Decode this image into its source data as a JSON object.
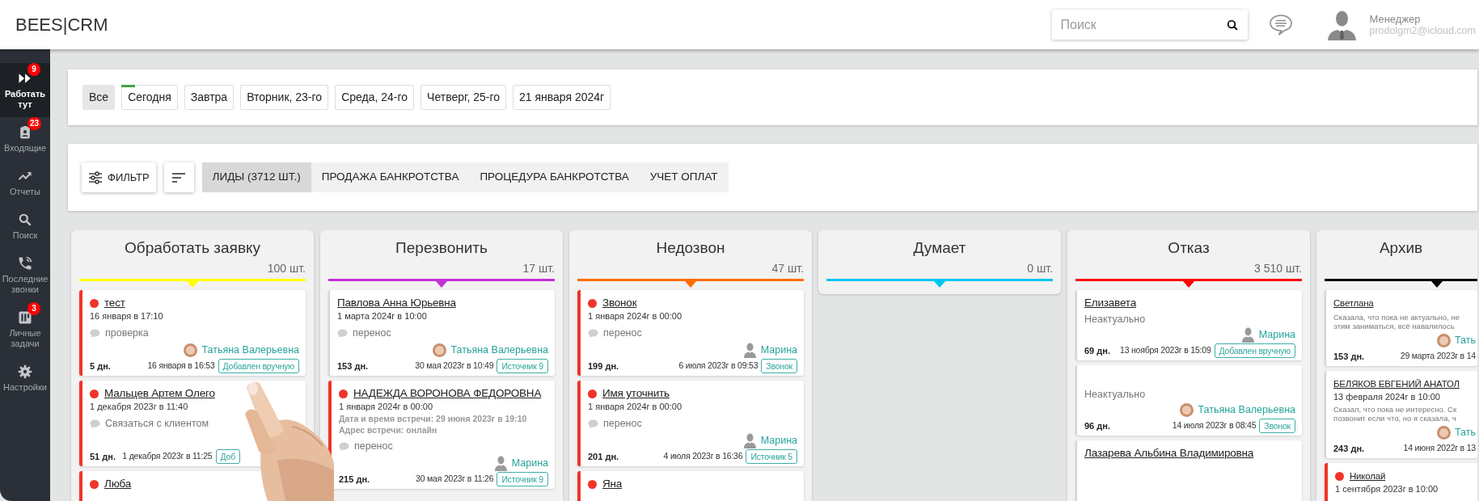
{
  "header": {
    "logo": "BEES|CRM",
    "search": {
      "placeholder": "Поиск"
    },
    "user": {
      "role": "Менеджер",
      "email": "prodolgm2@icloud.com"
    }
  },
  "sidebar": {
    "items": [
      {
        "kind": "forward",
        "label": "Работать тут",
        "badge": "9",
        "selected": true
      },
      {
        "kind": "inbox",
        "label": "Входящие",
        "badge": "23",
        "selected": false
      },
      {
        "kind": "chart",
        "label": "Отчеты",
        "selected": false
      },
      {
        "kind": "search",
        "label": "Поиск",
        "selected": false
      },
      {
        "kind": "phone",
        "label": "Последние звонки",
        "selected": false
      },
      {
        "kind": "board",
        "label": "Личные задачи",
        "badge": "3",
        "selected": false
      },
      {
        "kind": "gear",
        "label": "Настройки",
        "selected": false
      }
    ]
  },
  "date_tabs": [
    {
      "label": "Все",
      "selected": true,
      "marked": false
    },
    {
      "label": "Сегодня",
      "selected": false,
      "marked": true
    },
    {
      "label": "Завтра",
      "selected": false,
      "marked": false
    },
    {
      "label": "Вторник, 23-го",
      "selected": false,
      "marked": false
    },
    {
      "label": "Среда, 24-го",
      "selected": false,
      "marked": false
    },
    {
      "label": "Четверг, 25-го",
      "selected": false,
      "marked": false
    },
    {
      "label": "21 января 2024г",
      "selected": false,
      "marked": false
    }
  ],
  "pipeline_bar": {
    "filter_button": "ФИЛЬТР",
    "tabs": [
      {
        "label": "ЛИДЫ (3712 ШТ.)",
        "selected": true
      },
      {
        "label": "ПРОДАЖА БАНКРОТСТВА",
        "selected": false
      },
      {
        "label": "ПРОЦЕДУРА БАНКРОТСТВА",
        "selected": false
      },
      {
        "label": "УЧЕТ ОПЛАТ",
        "selected": false
      }
    ]
  },
  "columns": [
    {
      "title": "Обработать заявку",
      "count": "100 шт.",
      "color": "#ffff00",
      "cards": [
        {
          "name": "тест",
          "flagged": true,
          "date": "16 января в 17:10",
          "comment": "проверка",
          "assignee": {
            "name": "Татьяна Валерьевна"
          },
          "days": "5 дн.",
          "updated": "16 января в 16:53",
          "source": "Добавлен вручную"
        },
        {
          "name": "Мальцев Артем Олего",
          "flagged": true,
          "obscured": true,
          "date": "1 декабря 2023г в 11:40",
          "comment": "Связаться с клиентом",
          "days": "51 дн.",
          "updated": "1 декабря 2023г в 11:25",
          "source": "Доб"
        },
        {
          "name": "Люба",
          "flagged": true
        }
      ]
    },
    {
      "title": "Перезвонить",
      "count": "17 шт.",
      "color": "#c42fd6",
      "cards": [
        {
          "name": "Павлова Анна Юрьевна",
          "flagged": false,
          "date": "1 марта 2024г в 10:00",
          "comment": "перенос",
          "assignee": {
            "name": "Татьяна Валерьевна"
          },
          "days": "153 дн.",
          "updated": "30 мая 2023г в 10:49",
          "source": "Источник 9"
        },
        {
          "name": "НАДЕЖДА ВОРОНОВА ФЕДОРОВНА",
          "flagged": true,
          "date": "1 января 2024г в 00:00",
          "meeting": [
            "Дата и время встречи: 29 июня 2023г в 19:10",
            "Адрес встречи: онлайн"
          ],
          "comment": "перенос",
          "assignee": {
            "name": "Марина",
            "kind": "silhouette"
          },
          "days": "215 дн.",
          "updated": "30 мая 2023г в 11:26",
          "source": "Источник 9"
        }
      ]
    },
    {
      "title": "Недозвон",
      "count": "47 шт.",
      "color": "#ff6d00",
      "cards": [
        {
          "name": "Звонок",
          "flagged": true,
          "date": "1 января 2024г в 00:00",
          "comment": "перенос",
          "assignee": {
            "name": "Марина",
            "kind": "silhouette"
          },
          "days": "199 дн.",
          "updated": "6 июля 2023г в 09:53",
          "source": "Звонок"
        },
        {
          "name": "Имя уточнить",
          "flagged": true,
          "date": "1 января 2024г в 00:00",
          "comment": "перенос",
          "assignee": {
            "name": "Марина",
            "kind": "silhouette"
          },
          "days": "201 дн.",
          "updated": "4 июля 2023г в 16:36",
          "source": "Источник 5"
        },
        {
          "name": "Яна",
          "flagged": true
        }
      ]
    },
    {
      "title": "Думает",
      "count": "0 шт.",
      "color": "#00c6f2"
    },
    {
      "title": "Отказ",
      "count": "3 510 шт.",
      "color": "#ff0000",
      "cards": [
        {
          "name": "Елизавета",
          "flagged": false,
          "note": "Неактуально",
          "assignee": {
            "name": "Марина",
            "kind": "silhouette"
          },
          "days": "69 дн.",
          "updated": "13 ноября 2023г в 15:09",
          "source": "Добавлен вручную"
        },
        {
          "flagged": false,
          "note": "Неактуально",
          "assignee": {
            "name": "Татьяна Валерьевна"
          },
          "days": "96 дн.",
          "updated": "14 июля 2023г в 08:45",
          "source": "Звонок"
        },
        {
          "name": "Лазарева Альбина Владимировна",
          "flagged": false
        }
      ]
    },
    {
      "title": "Архив",
      "color": "#000000",
      "cards": [
        {
          "name": "Светлана",
          "flagged": false,
          "note": "Сказала, что пока не актуально, не этим заниматься, всё навалилось",
          "assignee": {
            "name": "Тать"
          },
          "days": "153 дн.",
          "updated": "29 марта 2023г в 14"
        },
        {
          "name": "БЕЛЯКОВ ЕВГЕНИЙ АНАТОЛ",
          "flagged": false,
          "date": "13 февраля 2024г в 10:00",
          "note": "Сказал, что пока не интересно. Ск позвонит если что, но я сказала, ч",
          "assignee": {
            "name": "Тать"
          },
          "days": "243 дн.",
          "updated": "14 июня 2022г в 13"
        },
        {
          "name": "Николай",
          "flagged": true,
          "date": "1 сентября 2023г в 10:00"
        }
      ]
    }
  ]
}
